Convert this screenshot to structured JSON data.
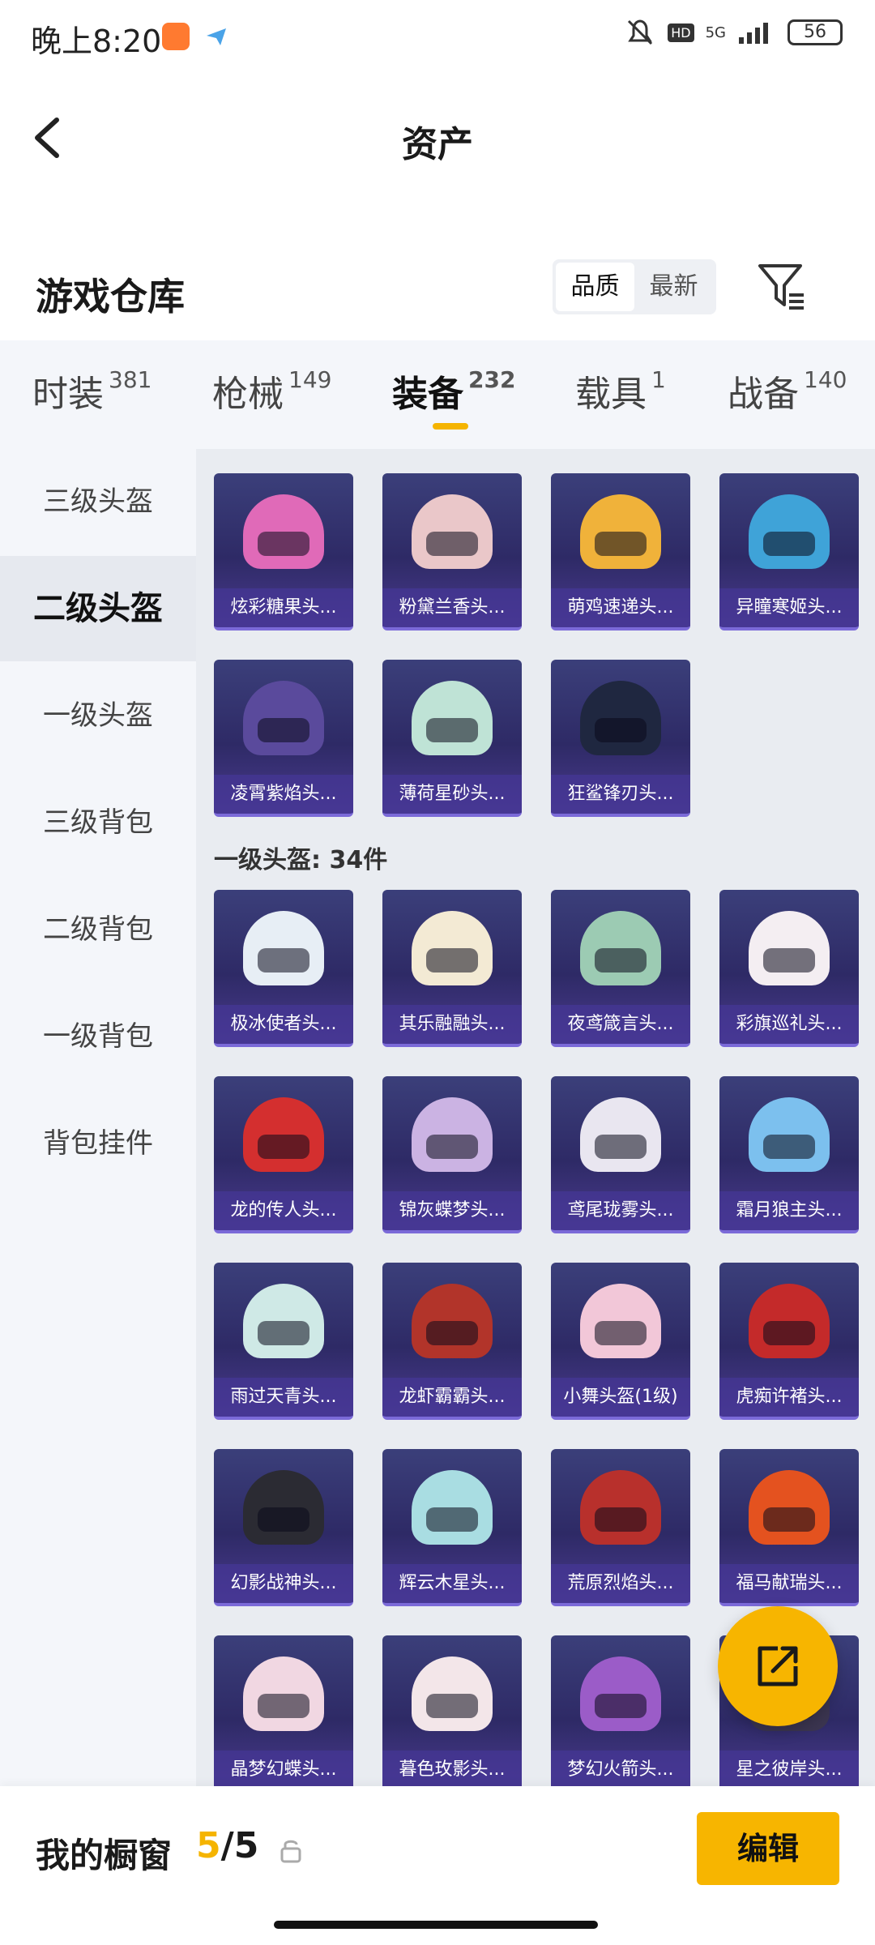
{
  "status": {
    "time": "晚上8:20",
    "network": "5G",
    "hd": "HD",
    "battery": "56"
  },
  "header": {
    "title": "资产"
  },
  "section": {
    "title": "游戏仓库",
    "sort_options": [
      "品质",
      "最新"
    ],
    "sort_selected": "品质"
  },
  "tabs": [
    {
      "label": "时装",
      "count": "381"
    },
    {
      "label": "枪械",
      "count": "149"
    },
    {
      "label": "装备",
      "count": "232"
    },
    {
      "label": "载具",
      "count": "1"
    },
    {
      "label": "战备",
      "count": "140"
    }
  ],
  "active_tab": "装备",
  "sidebar": {
    "items": [
      "三级头盔",
      "二级头盔",
      "一级头盔",
      "三级背包",
      "二级背包",
      "一级背包",
      "背包挂件"
    ],
    "active": "二级头盔"
  },
  "groups": {
    "level2_items": [
      "炫彩糖果头...",
      "粉黛兰香头...",
      "萌鸡速递头...",
      "异瞳寒姬头...",
      "凌霄紫焰头...",
      "薄荷星砂头...",
      "狂鲨锋刃头..."
    ],
    "level1_title": "一级头盔: 34件",
    "level1_items": [
      "极冰使者头...",
      "其乐融融头...",
      "夜鸢箴言头...",
      "彩旗巡礼头...",
      "龙的传人头...",
      "锦灰蝶梦头...",
      "鸢尾珑雾头...",
      "霜月狼主头...",
      "雨过天青头...",
      "龙虾霸霸头...",
      "小舞头盔(1级)",
      "虎痴许褚头...",
      "幻影战神头...",
      "辉云木星头...",
      "荒原烈焰头...",
      "福马献瑞头...",
      "晶梦幻蝶头...",
      "暮色玫影头...",
      "梦幻火箭头...",
      "星之彼岸头..."
    ]
  },
  "bottom": {
    "showcase_label": "我的橱窗",
    "showcase_current": "5",
    "showcase_sep": "/",
    "showcase_total": "5",
    "edit_label": "编辑"
  },
  "colors": {
    "accent": "#f7b500",
    "card_bg": "#2e2a66"
  }
}
